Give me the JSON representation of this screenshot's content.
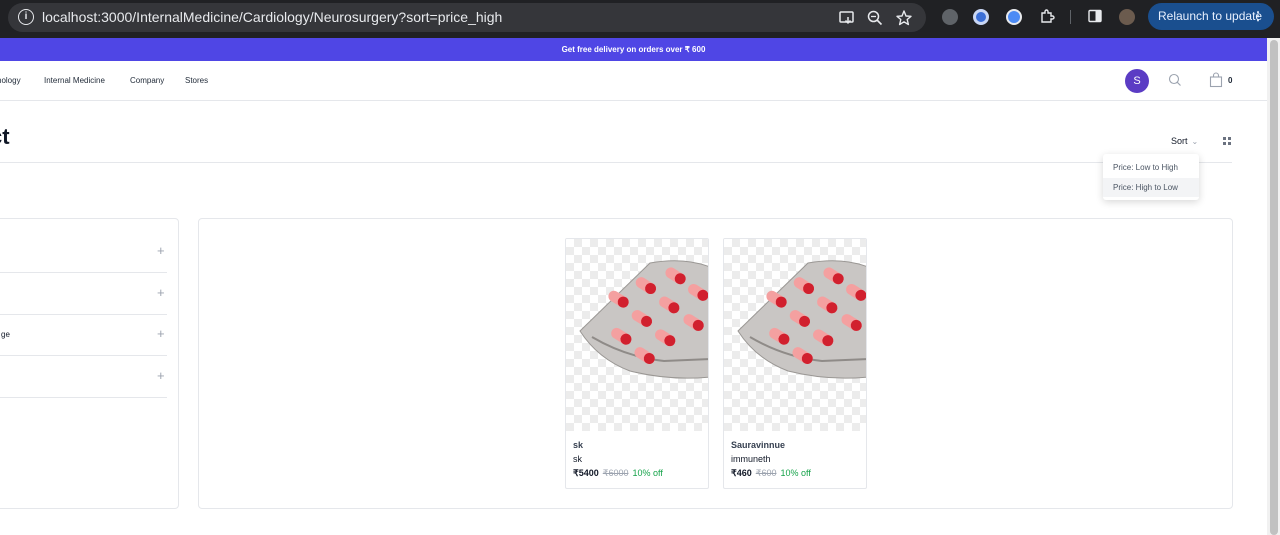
{
  "browser": {
    "url": "localhost:3000/InternalMedicine/Cardiology/Neurosurgery?sort=price_high",
    "relaunch_label": "Relaunch to update"
  },
  "announcement": "Get free delivery on orders over ₹ 600",
  "nav": {
    "links": [
      "nology",
      "Internal Medicine",
      "Company",
      "Stores"
    ],
    "avatar_initial": "S",
    "cart_count": "0"
  },
  "page": {
    "title": "ct",
    "sort_label": "Sort"
  },
  "sort_menu": {
    "options": [
      "Price: Low to High",
      "Price: High to Low"
    ],
    "selected": "Price: High to Low"
  },
  "filters": [
    {
      "label": ""
    },
    {
      "label": ""
    },
    {
      "label": "ge"
    },
    {
      "label": ""
    }
  ],
  "products": [
    {
      "name": "sk",
      "subtitle": "sk",
      "price": "₹5400",
      "original_price": "₹6000",
      "discount": "10% off"
    },
    {
      "name": "Sauravinnue",
      "subtitle": "immuneth",
      "price": "₹460",
      "original_price": "₹600",
      "discount": "10% off"
    }
  ],
  "colors": {
    "announcement_bg": "#4f46e5",
    "avatar_bg": "#5b3cc4",
    "discount": "#16a34a",
    "pill_red": "#d1202e",
    "pill_pink": "#f4a0a0"
  }
}
